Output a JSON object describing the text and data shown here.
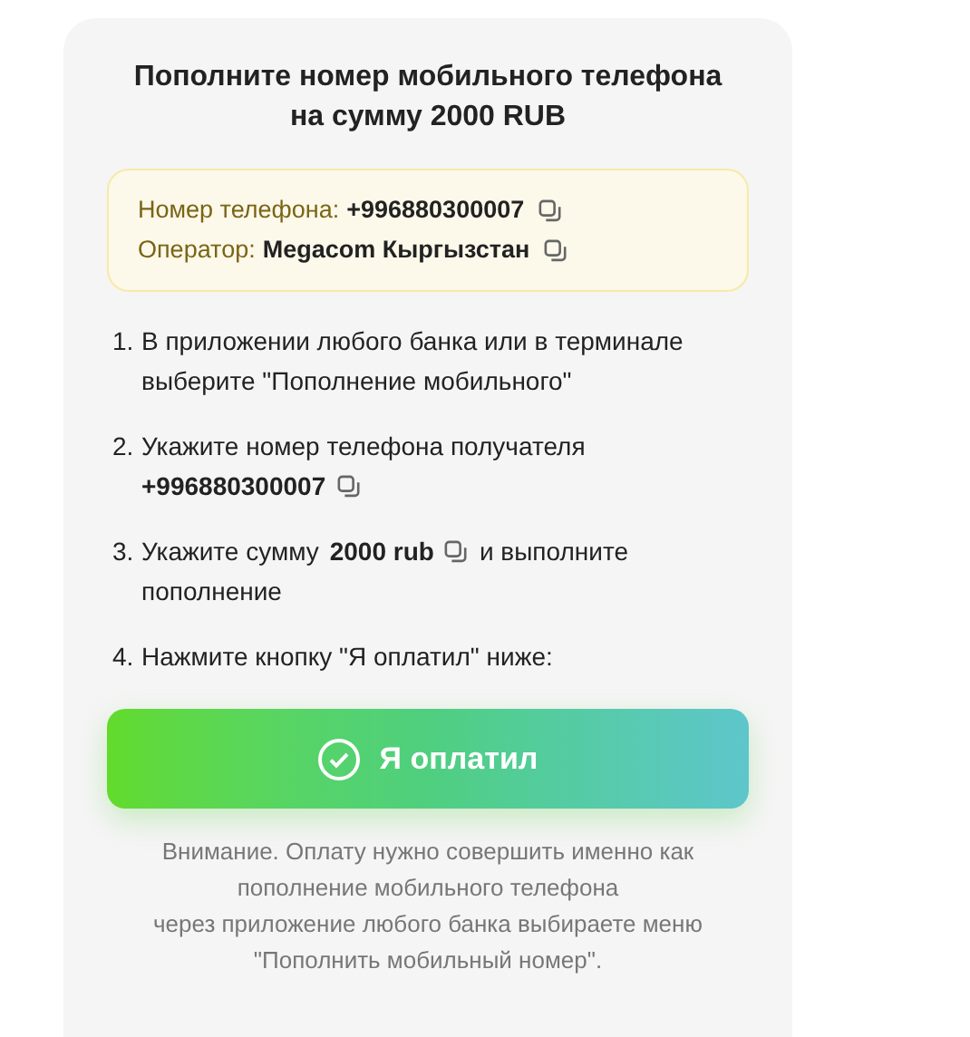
{
  "title_lines": [
    "Пополните номер мобильного телефона",
    "на сумму 2000 RUB"
  ],
  "info": [
    {
      "label": "Номер телефона:",
      "value": "+996880300007",
      "copyable": true
    },
    {
      "label": "Оператор:",
      "value": "Megacom Кыргызстан",
      "copyable": true
    }
  ],
  "steps": [
    {
      "number": "1.",
      "parts": [
        {
          "kind": "text",
          "text": "В приложении любого банка или в терминале выберите \"Пополнение мобильного\""
        }
      ]
    },
    {
      "number": "2.",
      "parts": [
        {
          "kind": "text",
          "text": "Укажите номер телефона получателя"
        },
        {
          "kind": "break"
        },
        {
          "kind": "bold",
          "text": "+996880300007"
        },
        {
          "kind": "copy"
        }
      ]
    },
    {
      "number": "3.",
      "parts": [
        {
          "kind": "text",
          "text": "Укажите сумму"
        },
        {
          "kind": "bold",
          "text": "2000 rub"
        },
        {
          "kind": "copy"
        },
        {
          "kind": "text",
          "text": "и выполните"
        },
        {
          "kind": "break"
        },
        {
          "kind": "text",
          "text": "пополнение"
        }
      ]
    },
    {
      "number": "4.",
      "parts": [
        {
          "kind": "text",
          "text": "Нажмите кнопку \"Я оплатил\" ниже:"
        }
      ]
    }
  ],
  "button": {
    "label": "Я оплатил"
  },
  "notice_lines": [
    "Внимание. Оплату нужно совершить именно как",
    "пополнение мобильного телефона",
    "через приложение любого банка выбираете меню",
    "\"Пополнить мобильный номер\"."
  ]
}
